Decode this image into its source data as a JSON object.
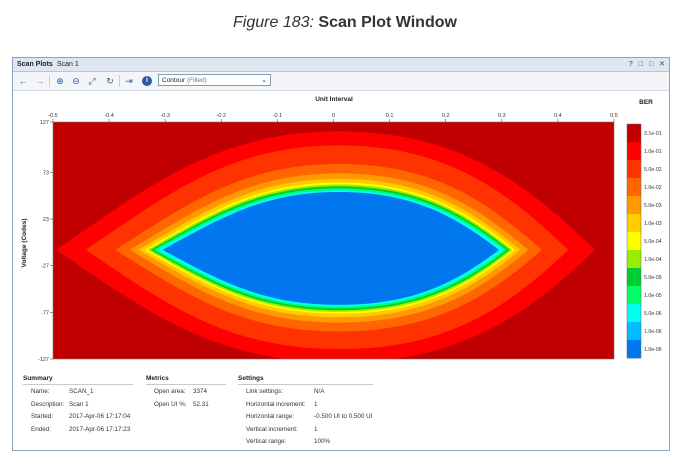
{
  "caption": {
    "figure": "Figure 183:",
    "title": "Scan Plot Window"
  },
  "window": {
    "title": "Scan Plots",
    "tab": "Scan 1",
    "controls": [
      "?",
      "□",
      "□",
      "✕"
    ]
  },
  "toolbar": {
    "plot_type_selected": "Contour",
    "plot_type_sub": "(Filled)"
  },
  "chart_data": {
    "type": "heatmap",
    "xlabel": "Unit Interval",
    "ylabel": "Voltage (Codes)",
    "xlim": [
      -0.5,
      0.5
    ],
    "ylim": [
      -127,
      127
    ],
    "x_ticks": [
      "-0.5",
      "-0.4",
      "-0.3",
      "-0.2",
      "-0.1",
      "0",
      "0.1",
      "0.2",
      "0.3",
      "0.4",
      "0.5"
    ],
    "y_ticks": [
      "127",
      "73",
      "23",
      "-27",
      "-77",
      "-127"
    ],
    "colorbar_title": "BER",
    "colorbar_levels": [
      {
        "label": "3.1e-01",
        "color": "#c00000"
      },
      {
        "label": "1.0e-01",
        "color": "#ff0000"
      },
      {
        "label": "5.0e-02",
        "color": "#ff3300"
      },
      {
        "label": "1.0e-02",
        "color": "#ff6600"
      },
      {
        "label": "5.0e-03",
        "color": "#ff9900"
      },
      {
        "label": "1.0e-03",
        "color": "#ffcc00"
      },
      {
        "label": "5.0e-04",
        "color": "#ffff00"
      },
      {
        "label": "1.0e-04",
        "color": "#99ee00"
      },
      {
        "label": "5.0e-05",
        "color": "#00cc33"
      },
      {
        "label": "1.0e-05",
        "color": "#00ff66"
      },
      {
        "label": "5.0e-06",
        "color": "#00ffee"
      },
      {
        "label": "1.0e-06",
        "color": "#00bbff"
      },
      {
        "label": "1.0e-06",
        "color": "#0077ee"
      }
    ],
    "eye_contours": [
      {
        "level": "3.1e-01",
        "color": "#c00000",
        "half_width_ui": 0.5,
        "half_height_codes": 127
      },
      {
        "level": "1.0e-01",
        "color": "#ff0000",
        "half_width_ui": 0.48,
        "half_height_codes": 127
      },
      {
        "level": "5.0e-02",
        "color": "#ff3300",
        "half_width_ui": 0.43,
        "half_height_codes": 112
      },
      {
        "level": "1.0e-02",
        "color": "#ff6600",
        "half_width_ui": 0.38,
        "half_height_codes": 92
      },
      {
        "level": "5.0e-03",
        "color": "#ff9900",
        "half_width_ui": 0.355,
        "half_height_codes": 82
      },
      {
        "level": "1.0e-03",
        "color": "#ffcc00",
        "half_width_ui": 0.34,
        "half_height_codes": 76
      },
      {
        "level": "5.0e-04",
        "color": "#ffff00",
        "half_width_ui": 0.33,
        "half_height_codes": 72
      },
      {
        "level": "1.0e-04",
        "color": "#99ee00",
        "half_width_ui": 0.325,
        "half_height_codes": 70
      },
      {
        "level": "5.0e-05",
        "color": "#00cc33",
        "half_width_ui": 0.32,
        "half_height_codes": 68
      },
      {
        "level": "1.0e-05",
        "color": "#00ff66",
        "half_width_ui": 0.315,
        "half_height_codes": 66
      },
      {
        "level": "5.0e-06",
        "color": "#00ffee",
        "half_width_ui": 0.31,
        "half_height_codes": 64
      },
      {
        "level": "1.0e-06",
        "color": "#0077ee",
        "half_width_ui": 0.3,
        "half_height_codes": 62
      }
    ]
  },
  "summary": {
    "header": "Summary",
    "rows": [
      {
        "label": "Name:",
        "value": "SCAN_1"
      },
      {
        "label": "Description:",
        "value": "Scan 1"
      },
      {
        "label": "Started:",
        "value": "2017-Apr-06 17:17:04"
      },
      {
        "label": "Ended:",
        "value": "2017-Apr-06 17:17:23"
      }
    ]
  },
  "metrics": {
    "header": "Metrics",
    "rows": [
      {
        "label": "Open area:",
        "value": "3374"
      },
      {
        "label": "Open UI %:",
        "value": "52.31"
      }
    ]
  },
  "settings": {
    "header": "Settings",
    "rows": [
      {
        "label": "Link settings:",
        "value": "N/A"
      },
      {
        "label": "Horizontal increment:",
        "value": "1"
      },
      {
        "label": "Horizontal range:",
        "value": "-0.500 UI to 0.500 UI"
      },
      {
        "label": "Vertical increment:",
        "value": "1"
      },
      {
        "label": "Vertical range:",
        "value": "100%"
      }
    ]
  }
}
